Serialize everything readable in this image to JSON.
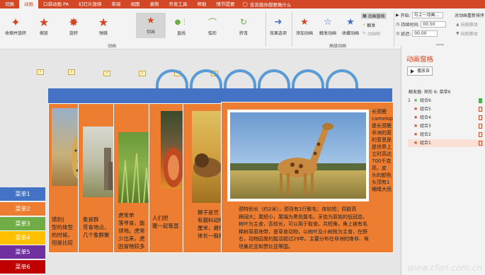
{
  "tabs": [
    "切换",
    "动画",
    "口袋动画 PA",
    "幻灯片放映",
    "审阅",
    "视图",
    "录制",
    "开发工具",
    "帮助",
    "情节提要"
  ],
  "tell_me": "告诉我你想要做什么",
  "effects": [
    {
      "label": "收缩并旋转"
    },
    {
      "label": "缩放"
    },
    {
      "label": "旋转"
    },
    {
      "label": "弹跳"
    },
    {
      "label": "切出"
    },
    {
      "label": "直线"
    },
    {
      "label": "弧形"
    },
    {
      "label": "转弯"
    }
  ],
  "ribbon": {
    "group_animation": "动画",
    "group_advanced": "高级动画",
    "group_timing": "计时",
    "effect_options": "效果选项",
    "add_animation": "添加动画",
    "anim_painter": "触发动画",
    "collect_anim": "收藏动画",
    "anim_pane": "动画窗格",
    "trigger": "触发",
    "anim_brush": "动画刷",
    "start_label": "开始:",
    "start_value": "与上一动画...",
    "duration_label": "持续时间:",
    "duration_value": "00.50",
    "delay_label": "延迟:",
    "delay_value": "00.00",
    "reorder": "对动画重新排序",
    "move_earlier": "向前移动",
    "move_later": "向后移动"
  },
  "pane": {
    "title": "动画窗格",
    "play": "播放自",
    "trigger": "触发器: 矩形 6: 菜单6",
    "items": [
      {
        "num": "1",
        "label": "组合6",
        "color": "#4caf50"
      },
      {
        "num": "",
        "label": "组合5",
        "color": "#d24726"
      },
      {
        "num": "",
        "label": "组合4",
        "color": "#d24726"
      },
      {
        "num": "",
        "label": "组合3",
        "color": "#d24726"
      },
      {
        "num": "",
        "label": "组合2",
        "color": "#d24726"
      },
      {
        "num": "",
        "label": "组合1",
        "color": "#d24726"
      }
    ]
  },
  "menu": [
    {
      "label": "菜单1",
      "color": "#4472c4"
    },
    {
      "label": "菜单2",
      "color": "#ed7d31"
    },
    {
      "label": "菜单3",
      "color": "#70ad47"
    },
    {
      "label": "菜单4",
      "color": "#ffc000"
    },
    {
      "label": "菜单5",
      "color": "#7030a0"
    },
    {
      "label": "菜单6",
      "color": "#c00000"
    }
  ],
  "captions": {
    "c1": "猎豹(\n型的体型\n的时候，\n但是比较",
    "c2": "象是群\n觅食地点，\n几个象群聚",
    "c3": "虎常单\n落寻食，能\n领地。虎常\n少出来，虎\n因食物较多",
    "c4": "人们把\n猩一起笔直",
    "c5": "狮子是世\n有猫科动物中\n厘米，雌兽\n体长一般都超",
    "c6_side": "长颈鹿\ncamelop\n是长颈鹿\n非洲的原\n的意思是\n是世界上\n立时高达\n700千克\n高，皮\n头的颜色\n头顶有1\n眼睛大而",
    "c6": "颈特别长（约2米），颈背有1行鬃毛；体较短；四肢高\n蹄阔大；尾短小，尾端为黑色簇毛，牙齿为原始的低冠齿，\n树叶为主食，舌较长，可以用于取食。共短角，角上被有毛\n稀树草原地带，是草食动物，以树叶及小树枝为主食，在野\n右，动物园里的能活超过29年。主要分布在非洲的南非、埃\n坦桑尼亚和赞比亚等国。"
  },
  "watermark": "www.cfan.com.cn"
}
